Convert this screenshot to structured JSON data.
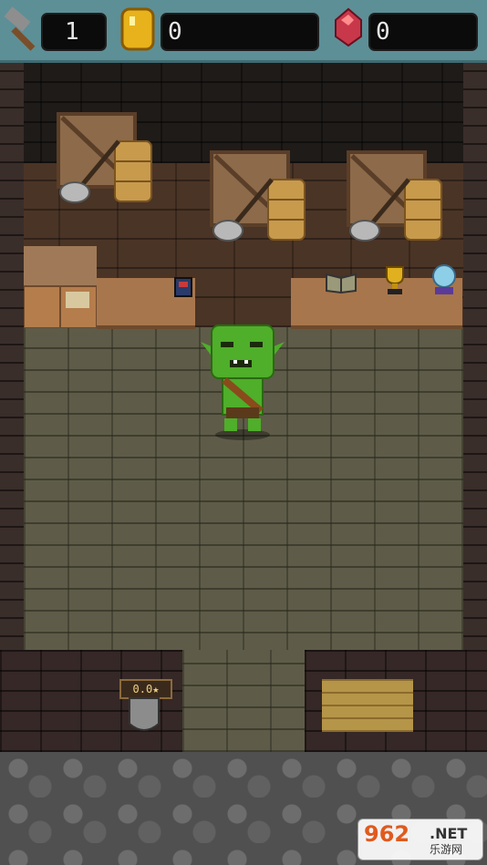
{
  "hud": {
    "hammer_count": "1",
    "coin_count": "0",
    "gem_count": "0"
  },
  "shop": {
    "rating": "0.0★"
  },
  "watermark": {
    "main": "962",
    "suffix": ".NET",
    "sub": "乐游网"
  },
  "colors": {
    "hud_bg": "#5d8f97",
    "coin": "#e8b21c",
    "gem": "#c9384a",
    "goblin": "#4fae2a"
  }
}
